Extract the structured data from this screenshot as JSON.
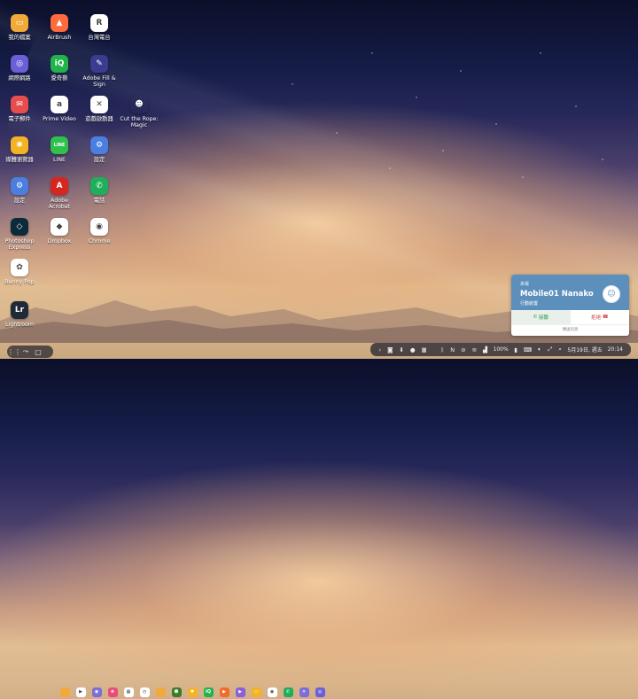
{
  "desktop": {
    "apps": [
      {
        "label": "我的檔案",
        "icon": "folder-icon",
        "color": "#f2a93b",
        "glyph": "▭"
      },
      {
        "label": "AirBrush",
        "icon": "airbrush-icon",
        "color": "#ff6b3d",
        "glyph": "▲"
      },
      {
        "label": "台灣電台",
        "icon": "radio-icon",
        "color": "#ffffff",
        "glyph": "R"
      },
      {
        "label": "網際網路",
        "icon": "internet-icon",
        "color": "#6a5fd8",
        "glyph": "◎"
      },
      {
        "label": "愛奇藝",
        "icon": "iqiyi-icon",
        "color": "#21b44a",
        "glyph": "iQ"
      },
      {
        "label": "Adobe Fill & Sign",
        "icon": "fill-sign-icon",
        "color": "#3b3b8f",
        "glyph": "✎"
      },
      {
        "label": "電子郵件",
        "icon": "email-icon",
        "color": "#e84d4d",
        "glyph": "✉"
      },
      {
        "label": "Prime Video",
        "icon": "prime-video-icon",
        "color": "#ffffff",
        "glyph": "a"
      },
      {
        "label": "遊戲啟動器",
        "icon": "game-launcher-icon",
        "color": "#ffffff",
        "glyph": "✕"
      },
      {
        "label": "Cut the Rope: Magic",
        "icon": "cut-the-rope-icon",
        "color": "transparent",
        "glyph": "☻"
      },
      {
        "label": "媒體瀏覽器",
        "icon": "media-browser-icon",
        "color": "#f4b324",
        "glyph": "✱"
      },
      {
        "label": "LINE",
        "icon": "line-icon",
        "color": "#2fc14b",
        "glyph": "LINE"
      },
      {
        "label": "設定",
        "icon": "settings-icon",
        "color": "#4a7fe0",
        "glyph": "⚙"
      },
      {
        "label": "設定",
        "icon": "settings-icon-2",
        "color": "#4a7fe0",
        "glyph": "⚙"
      },
      {
        "label": "Adobe Acrobat",
        "icon": "acrobat-icon",
        "color": "#d7261e",
        "glyph": "A"
      },
      {
        "label": "電話",
        "icon": "phone-icon",
        "color": "#1fae5a",
        "glyph": "✆"
      },
      {
        "label": "Photoshop Express",
        "icon": "photoshop-express-icon",
        "color": "#0b2b3a",
        "glyph": "◇"
      },
      {
        "label": "Dropbox",
        "icon": "dropbox-icon",
        "color": "#ffffff",
        "glyph": "◆"
      },
      {
        "label": "Chrome",
        "icon": "chrome-icon",
        "color": "#ffffff",
        "glyph": "◉"
      },
      {
        "label": "Bunny Pop",
        "icon": "bunny-pop-icon",
        "color": "#ffffff",
        "glyph": "✿"
      },
      {
        "label": "Lightroom",
        "icon": "lightroom-icon",
        "color": "#1f2a38",
        "glyph": "Lr"
      }
    ]
  },
  "call": {
    "small_label": "來電",
    "caller": "Mobile01 Nanako",
    "sub": "行動裝置",
    "answer": "接聽",
    "decline": "拒絕",
    "footer": "傳送訊息"
  },
  "taskbar": {
    "apps": [
      {
        "name": "files",
        "color": "#f2a93b",
        "glyph": ""
      },
      {
        "name": "play-store",
        "color": "#ffffff",
        "glyph": "▶"
      },
      {
        "name": "camera",
        "color": "#7b6fd6",
        "glyph": "◉"
      },
      {
        "name": "gallery",
        "color": "#e84d7a",
        "glyph": "❀"
      },
      {
        "name": "calendar",
        "color": "#ffffff",
        "glyph": "▦"
      },
      {
        "name": "clock",
        "color": "#ffffff",
        "glyph": "◷"
      },
      {
        "name": "folder",
        "color": "#f2a93b",
        "glyph": ""
      },
      {
        "name": "cut-the-rope",
        "color": "#3c7a2b",
        "glyph": "☻"
      },
      {
        "name": "bulb",
        "color": "#f4b324",
        "glyph": "✱"
      },
      {
        "name": "iqiyi",
        "color": "#21b44a",
        "glyph": "iQ"
      },
      {
        "name": "video",
        "color": "#f26b2a",
        "glyph": "▶"
      },
      {
        "name": "purple",
        "color": "#8a5fd8",
        "glyph": "▶"
      },
      {
        "name": "yellow",
        "color": "#f4b324",
        "glyph": "▭"
      },
      {
        "name": "chrome",
        "color": "#ffffff",
        "glyph": "◉"
      },
      {
        "name": "phone",
        "color": "#1fae5a",
        "glyph": "✆"
      },
      {
        "name": "gamepad",
        "color": "#7b6fd6",
        "glyph": "✕"
      },
      {
        "name": "internet",
        "color": "#6a5fd8",
        "glyph": "◎"
      }
    ],
    "battery": "100%",
    "date": "5月19日, 週五",
    "time": "20:14"
  }
}
